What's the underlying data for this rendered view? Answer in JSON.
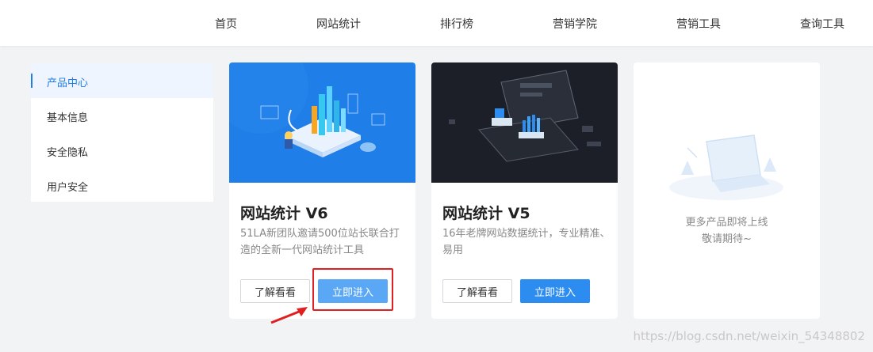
{
  "nav": {
    "items": [
      "首页",
      "网站统计",
      "排行榜",
      "营销学院",
      "营销工具",
      "查询工具"
    ]
  },
  "sidebar": {
    "items": [
      {
        "label": "产品中心",
        "active": true
      },
      {
        "label": "基本信息",
        "active": false
      },
      {
        "label": "安全隐私",
        "active": false
      },
      {
        "label": "用户安全",
        "active": false
      }
    ]
  },
  "cards": [
    {
      "title": "网站统计 V6",
      "desc": "51LA新团队邀请500位站长联合打造的全新一代网站统计工具",
      "learn_label": "了解看看",
      "enter_label": "立即进入",
      "theme": "#1f7ee8"
    },
    {
      "title": "网站统计 V5",
      "desc": "16年老牌网站数据统计，专业精准、易用",
      "learn_label": "了解看看",
      "enter_label": "立即进入",
      "theme": "#1c1f27"
    }
  ],
  "more_card": {
    "line1": "更多产品即将上线",
    "line2": "敬请期待~"
  },
  "colors": {
    "accent": "#2d8cf0",
    "annotation": "#e02020"
  },
  "watermark": "https://blog.csdn.net/weixin_54348802"
}
